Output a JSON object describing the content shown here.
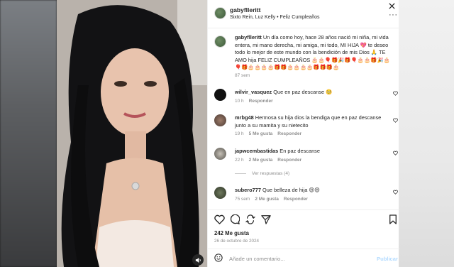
{
  "post": {
    "username": "gabyflleritt",
    "subtitle": "Sixto Rein, Luz Kelly • Feliz Cumpleaños",
    "caption_user": "gabyflleritt",
    "caption_text": " Un día como hoy, hace 28 años nació mi niña, mi vida entera, mi mano derecha, mi amiga, mi todo, MI HIJA 💖 te deseo todo lo mejor de este mundo con la bendición de mis Dios 🙏 TE AMO hija FELIZ CUMPLEAÑOS 🎂🎂🎈🎁🎉🎁🎈🎂🎂🎁🎉🎂🎈🎁🎂🎂🎂🎂🎁🎁🎂🎂🎂🎂🎁🎁🎁🎂",
    "caption_time": "87 sem"
  },
  "comments": [
    {
      "user": "wilvir_vasquez",
      "text": "Que en paz descanse 🥺",
      "time": "10 h",
      "reply": "Responder",
      "likes": ""
    },
    {
      "user": "mrbg48",
      "text": "Hermosa su hija dios la bendiga que en paz descanse junto a su mamita y su nietecito",
      "time": "19 h",
      "likes": "5 Me gusta",
      "reply": "Responder"
    },
    {
      "user": "japwcembastidas",
      "text": "En paz descanse",
      "time": "22 h",
      "likes": "2 Me gusta",
      "reply": "Responder",
      "view_replies": "Ver respuestas (4)"
    },
    {
      "user": "subero777",
      "text": "Que belleza de hija 😍😍",
      "time": "75 sem",
      "likes": "2 Me gusta",
      "reply": "Responder"
    }
  ],
  "footer": {
    "likes": "242 Me gusta",
    "date": "26 de octubre de 2024",
    "placeholder": "Añade un comentario...",
    "publish": "Publicar"
  },
  "icons": [
    "close-icon",
    "more-icon",
    "heart-icon",
    "comment-icon",
    "share-icon",
    "bookmark-icon",
    "emoji-icon",
    "sound-icon"
  ],
  "colors": {
    "link": "#0095f6",
    "muted": "#8e8e8e",
    "text": "#262626"
  }
}
